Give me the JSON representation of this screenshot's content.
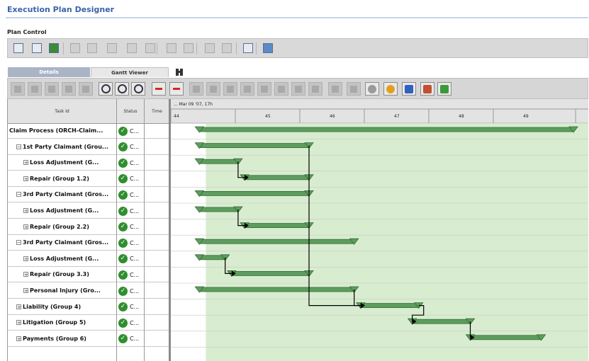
{
  "window": {
    "title": "Execution Plan Designer"
  },
  "plan_control": {
    "label": "Plan Control"
  },
  "tabs": [
    {
      "label": "Details",
      "active": false
    },
    {
      "label": "Gantt Viewer",
      "active": true
    }
  ],
  "grid": {
    "columns": [
      "Task Id",
      "Status",
      "Time"
    ],
    "rows": [
      {
        "name": "Claim Process (ORCH-Claim...",
        "status": "C...",
        "indent": 0,
        "expander": ""
      },
      {
        "name": "1st Party Claimant (Grou...",
        "status": "C...",
        "indent": 1,
        "expander": "⊟"
      },
      {
        "name": "Loss Adjustment (G...",
        "status": "C...",
        "indent": 2,
        "expander": "⊞"
      },
      {
        "name": "Repair (Group 1.2)",
        "status": "C...",
        "indent": 2,
        "expander": "⊞"
      },
      {
        "name": "3rd Party Claimant (Gros...",
        "status": "C...",
        "indent": 1,
        "expander": "⊟"
      },
      {
        "name": "Loss Adjustment (G...",
        "status": "C...",
        "indent": 2,
        "expander": "⊞"
      },
      {
        "name": "Repair (Group 2.2)",
        "status": "C...",
        "indent": 2,
        "expander": "⊞"
      },
      {
        "name": "3rd Party Claimant (Gros...",
        "status": "C...",
        "indent": 1,
        "expander": "⊟"
      },
      {
        "name": "Loss Adjustment (G...",
        "status": "C...",
        "indent": 2,
        "expander": "⊞"
      },
      {
        "name": "Repair (Group 3.3)",
        "status": "C...",
        "indent": 2,
        "expander": "⊞"
      },
      {
        "name": "Personal Injury (Gro...",
        "status": "C...",
        "indent": 2,
        "expander": "⊞"
      },
      {
        "name": "Liability (Group 4)",
        "status": "C...",
        "indent": 1,
        "expander": "⊞"
      },
      {
        "name": "Litigation (Group 5)",
        "status": "C...",
        "indent": 1,
        "expander": "⊞"
      },
      {
        "name": "Payments (Group 6)",
        "status": "C...",
        "indent": 1,
        "expander": "⊞"
      }
    ]
  },
  "timeline": {
    "date_label": "... Mar 09 '07, 17h",
    "ticks": [
      "44",
      "45",
      "46",
      "47",
      "48",
      "49"
    ],
    "bars": [
      {
        "start": 44.3,
        "end": 50.1
      },
      {
        "start": 44.3,
        "end": 46.0
      },
      {
        "start": 44.3,
        "end": 44.9
      },
      {
        "start": 45.0,
        "end": 46.0
      },
      {
        "start": 44.3,
        "end": 46.0
      },
      {
        "start": 44.3,
        "end": 44.9
      },
      {
        "start": 45.0,
        "end": 46.0
      },
      {
        "start": 44.3,
        "end": 46.7
      },
      {
        "start": 44.3,
        "end": 44.7
      },
      {
        "start": 44.8,
        "end": 46.0
      },
      {
        "start": 44.3,
        "end": 46.7
      },
      {
        "start": 46.8,
        "end": 47.7
      },
      {
        "start": 47.6,
        "end": 48.5
      },
      {
        "start": 48.5,
        "end": 49.6
      }
    ],
    "shade_start": 44.4,
    "colors": {
      "bar": "#5f9c5f",
      "bar_edge": "#2f6f2f",
      "shade": "#d8ecd0",
      "link": "#000000"
    }
  },
  "icons": {
    "plan_toolbar": [
      "save-icon",
      "copy-icon",
      "export-icon",
      "edit-icon",
      "refresh-icon",
      "grid-icon",
      "play-icon",
      "tools-icon",
      "pin-icon",
      "search-icon",
      "print-icon",
      "filter-icon",
      "book-icon",
      "chart-icon"
    ],
    "gantt_toolbar": [
      "page-icon",
      "page-icon",
      "page-icon",
      "page-icon",
      "page-icon",
      "zoom-out-icon",
      "zoom-in-icon",
      "zoom-fit-icon",
      "add-icon",
      "remove-icon",
      "up-icon",
      "down-icon",
      "left-icon",
      "right-icon",
      "delete-icon",
      "copy-icon",
      "record-icon",
      "play-icon",
      "table-icon",
      "table-icon",
      "circle-icon",
      "color-icon",
      "image-icon",
      "palette-icon",
      "picture-icon"
    ]
  }
}
